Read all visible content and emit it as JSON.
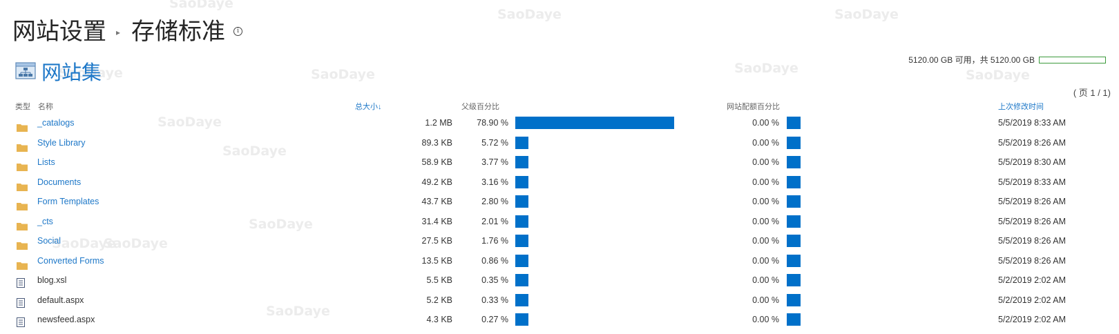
{
  "header": {
    "breadcrumb_parent": "网站设置",
    "breadcrumb_current": "存储标准",
    "info_icon": "info-icon"
  },
  "site_collection": {
    "title": "网站集",
    "icon": "site-collection-icon"
  },
  "storage": {
    "summary": "5120.00 GB 可用，共 5120.00 GB",
    "used_fraction": 0.0
  },
  "pager": "( 页 1 / 1)",
  "columns": {
    "type": "类型",
    "name": "名称",
    "total_size": "总大小",
    "sort_indicator": "↓",
    "parent_percent": "父级百分比",
    "quota_percent": "网站配额百分比",
    "last_modified": "上次修改时间"
  },
  "rows": [
    {
      "type": "folder",
      "name": "_catalogs",
      "size": "1.2 MB",
      "pct": "78.90 %",
      "pct_value": 78.9,
      "quota": "0.00 %",
      "date": "5/5/2019 8:33 AM"
    },
    {
      "type": "folder",
      "name": "Style Library",
      "size": "89.3 KB",
      "pct": "5.72 %",
      "pct_value": 5.72,
      "quota": "0.00 %",
      "date": "5/5/2019 8:26 AM"
    },
    {
      "type": "folder",
      "name": "Lists",
      "size": "58.9 KB",
      "pct": "3.77 %",
      "pct_value": 3.77,
      "quota": "0.00 %",
      "date": "5/5/2019 8:30 AM"
    },
    {
      "type": "folder",
      "name": "Documents",
      "size": "49.2 KB",
      "pct": "3.16 %",
      "pct_value": 3.16,
      "quota": "0.00 %",
      "date": "5/5/2019 8:33 AM"
    },
    {
      "type": "folder",
      "name": "Form Templates",
      "size": "43.7 KB",
      "pct": "2.80 %",
      "pct_value": 2.8,
      "quota": "0.00 %",
      "date": "5/5/2019 8:26 AM"
    },
    {
      "type": "folder",
      "name": "_cts",
      "size": "31.4 KB",
      "pct": "2.01 %",
      "pct_value": 2.01,
      "quota": "0.00 %",
      "date": "5/5/2019 8:26 AM"
    },
    {
      "type": "folder",
      "name": "Social",
      "size": "27.5 KB",
      "pct": "1.76 %",
      "pct_value": 1.76,
      "quota": "0.00 %",
      "date": "5/5/2019 8:26 AM"
    },
    {
      "type": "folder",
      "name": "Converted Forms",
      "size": "13.5 KB",
      "pct": "0.86 %",
      "pct_value": 0.86,
      "quota": "0.00 %",
      "date": "5/5/2019 8:26 AM"
    },
    {
      "type": "file",
      "name": "blog.xsl",
      "size": "5.5 KB",
      "pct": "0.35 %",
      "pct_value": 0.35,
      "quota": "0.00 %",
      "date": "5/2/2019 2:02 AM"
    },
    {
      "type": "file",
      "name": "default.aspx",
      "size": "5.2 KB",
      "pct": "0.33 %",
      "pct_value": 0.33,
      "quota": "0.00 %",
      "date": "5/2/2019 2:02 AM"
    },
    {
      "type": "file",
      "name": "newsfeed.aspx",
      "size": "4.3 KB",
      "pct": "0.27 %",
      "pct_value": 0.27,
      "quota": "0.00 %",
      "date": "5/2/2019 2:02 AM"
    }
  ],
  "watermark": "SaoDaye",
  "colors": {
    "link": "#1e78c8",
    "bar": "#0070c9",
    "storage_bar": "#3a9a3a",
    "folder": "#e8b451"
  }
}
